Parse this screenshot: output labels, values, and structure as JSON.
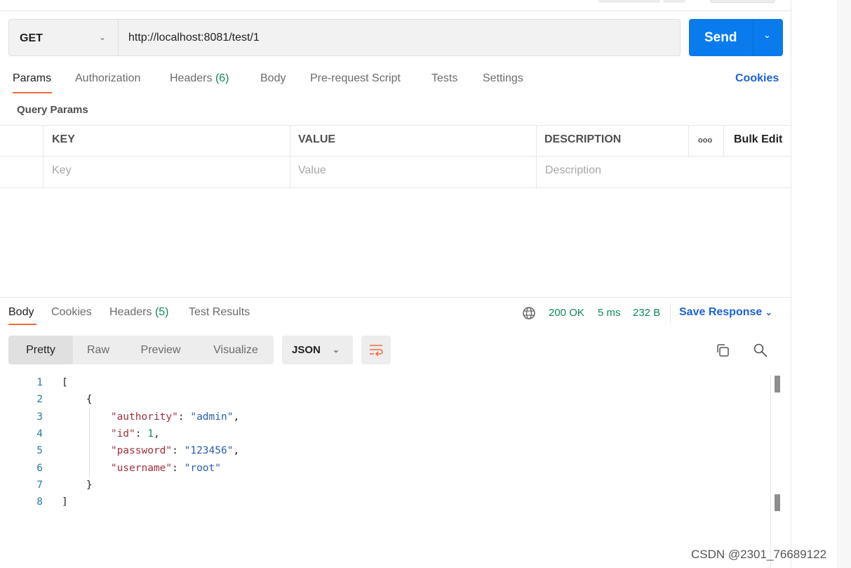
{
  "request": {
    "method": "GET",
    "url": "http://localhost:8081/test/1",
    "send_label": "Send"
  },
  "request_tabs": [
    {
      "label": "Params",
      "active": true
    },
    {
      "label": "Authorization"
    },
    {
      "label": "Headers",
      "count": "(6)"
    },
    {
      "label": "Body"
    },
    {
      "label": "Pre-request Script"
    },
    {
      "label": "Tests"
    },
    {
      "label": "Settings"
    }
  ],
  "cookies_label": "Cookies",
  "query_params": {
    "title": "Query Params",
    "headers": {
      "key": "KEY",
      "value": "VALUE",
      "description": "DESCRIPTION",
      "more": "ooo",
      "bulk_edit": "Bulk Edit"
    },
    "placeholders": {
      "key": "Key",
      "value": "Value",
      "description": "Description"
    }
  },
  "response": {
    "tabs": [
      {
        "label": "Body",
        "active": true
      },
      {
        "label": "Cookies"
      },
      {
        "label": "Headers",
        "count": "(5)"
      },
      {
        "label": "Test Results"
      }
    ],
    "status": "200 OK",
    "time": "5 ms",
    "size": "232 B",
    "save_label": "Save Response",
    "views": [
      "Pretty",
      "Raw",
      "Preview",
      "Visualize"
    ],
    "selected_view": "Pretty",
    "format": "JSON",
    "lines": [
      [
        {
          "t": "[",
          "c": "pun"
        }
      ],
      [
        {
          "t": "    {",
          "c": "pun"
        }
      ],
      [
        {
          "t": "        \"authority\"",
          "c": "key"
        },
        {
          "t": ": ",
          "c": "pun"
        },
        {
          "t": "\"admin\"",
          "c": "str"
        },
        {
          "t": ",",
          "c": "pun"
        }
      ],
      [
        {
          "t": "        \"id\"",
          "c": "key"
        },
        {
          "t": ": ",
          "c": "pun"
        },
        {
          "t": "1",
          "c": "num"
        },
        {
          "t": ",",
          "c": "pun"
        }
      ],
      [
        {
          "t": "        \"password\"",
          "c": "key"
        },
        {
          "t": ": ",
          "c": "pun"
        },
        {
          "t": "\"123456\"",
          "c": "str"
        },
        {
          "t": ",",
          "c": "pun"
        }
      ],
      [
        {
          "t": "        \"username\"",
          "c": "key"
        },
        {
          "t": ": ",
          "c": "pun"
        },
        {
          "t": "\"root\"",
          "c": "str"
        }
      ],
      [
        {
          "t": "    }",
          "c": "pun"
        }
      ],
      [
        {
          "t": "]",
          "c": "pun"
        }
      ]
    ]
  },
  "colors": {
    "accent": "#097bed",
    "tab_underline": "#f26b3a",
    "status": "#0f8a58",
    "link": "#1d62d6"
  },
  "watermark": "CSDN @2301_76689122"
}
